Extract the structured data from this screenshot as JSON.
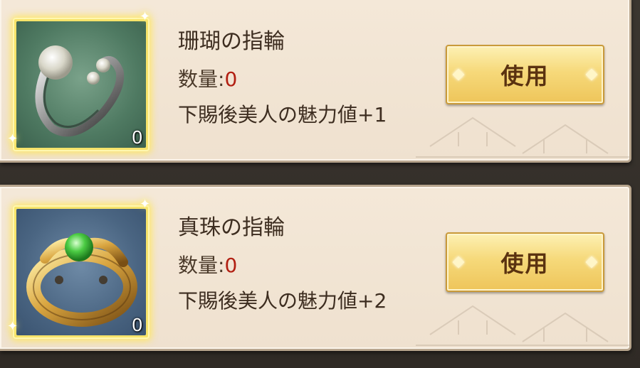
{
  "items": [
    {
      "name": "珊瑚の指輪",
      "qty_label": "数量:",
      "qty_value": "0",
      "effect": "下賜後美人の魅力値+1",
      "icon": "pearl-ring-icon",
      "count": "0",
      "button": "使用"
    },
    {
      "name": "真珠の指輪",
      "qty_label": "数量:",
      "qty_value": "0",
      "effect": "下賜後美人の魅力値+2",
      "icon": "jade-gold-ring-icon",
      "count": "0",
      "button": "使用"
    }
  ]
}
